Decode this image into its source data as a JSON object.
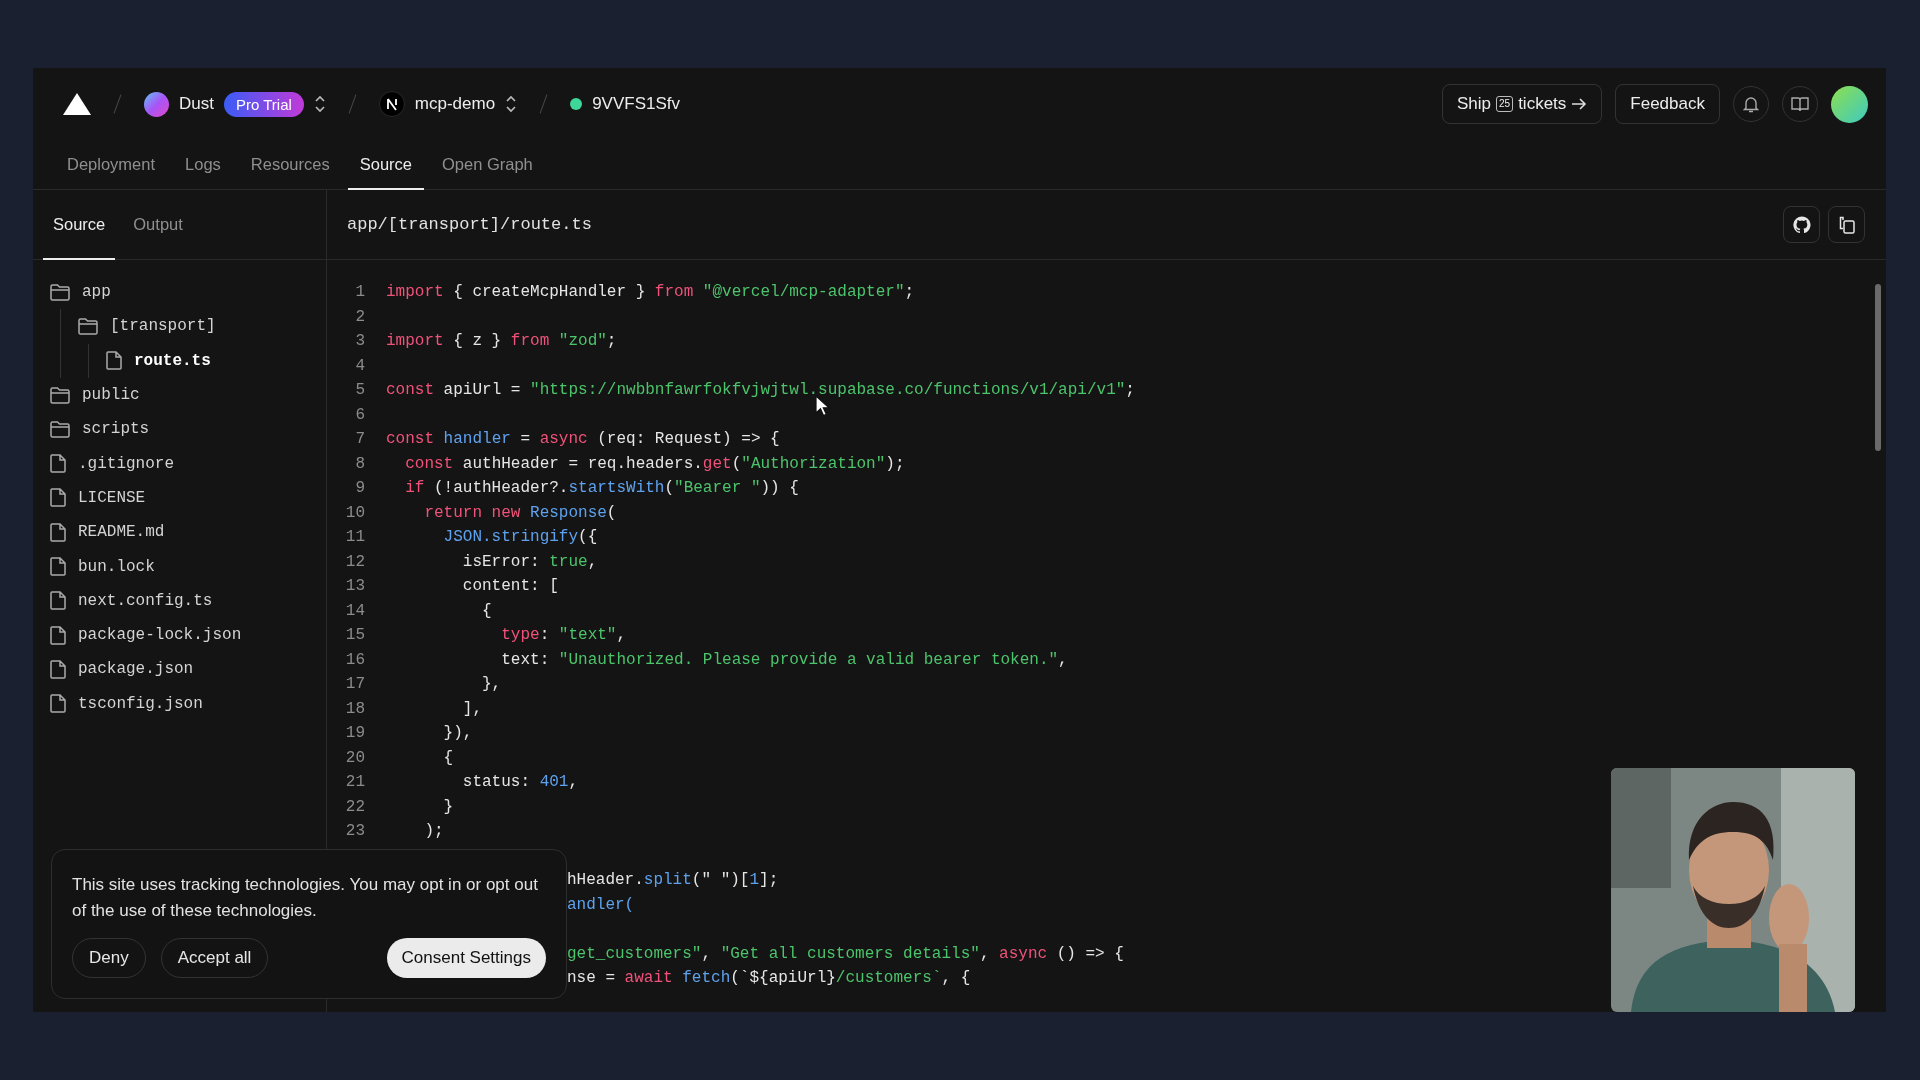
{
  "header": {
    "team": "Dust",
    "plan_badge": "Pro Trial",
    "project": "mcp-demo",
    "deployment": "9VVFS1Sfv",
    "ship_button": {
      "label": "Ship",
      "count": "25",
      "suffix": "tickets"
    },
    "feedback_button": "Feedback"
  },
  "tabs": [
    {
      "label": "Deployment",
      "selected": false
    },
    {
      "label": "Logs",
      "selected": false
    },
    {
      "label": "Resources",
      "selected": false
    },
    {
      "label": "Source",
      "selected": true
    },
    {
      "label": "Open Graph",
      "selected": false
    }
  ],
  "panel_tabs": [
    {
      "label": "Source",
      "selected": true
    },
    {
      "label": "Output",
      "selected": false
    }
  ],
  "file_tree": [
    {
      "name": "app",
      "kind": "folder",
      "selected": false,
      "children": [
        {
          "name": "[transport]",
          "kind": "folder",
          "selected": false,
          "children": [
            {
              "name": "route.ts",
              "kind": "file",
              "selected": true
            }
          ]
        }
      ]
    },
    {
      "name": "public",
      "kind": "folder",
      "selected": false
    },
    {
      "name": "scripts",
      "kind": "folder",
      "selected": false
    },
    {
      "name": ".gitignore",
      "kind": "file",
      "selected": false
    },
    {
      "name": "LICENSE",
      "kind": "file",
      "selected": false
    },
    {
      "name": "README.md",
      "kind": "file",
      "selected": false
    },
    {
      "name": "bun.lock",
      "kind": "file",
      "selected": false
    },
    {
      "name": "next.config.ts",
      "kind": "file",
      "selected": false
    },
    {
      "name": "package-lock.json",
      "kind": "file",
      "selected": false
    },
    {
      "name": "package.json",
      "kind": "file",
      "selected": false
    },
    {
      "name": "tsconfig.json",
      "kind": "file",
      "selected": false
    }
  ],
  "file_path": "app/[transport]/route.ts",
  "code_lines": [
    {
      "kind": "full",
      "number": "1",
      "tokens": [
        {
          "kind": "keyword",
          "text": "import"
        },
        {
          "kind": "plain",
          "text": " { createMcpHandler } "
        },
        {
          "kind": "keyword",
          "text": "from"
        },
        {
          "kind": "string",
          "text": " \"@vercel/mcp-adapter\""
        },
        {
          "kind": "plain",
          "text": ";"
        }
      ]
    },
    {
      "kind": "full",
      "number": "2"
    },
    {
      "kind": "full",
      "number": "3",
      "tokens": [
        {
          "kind": "keyword",
          "text": "import"
        },
        {
          "kind": "plain",
          "text": " { z } "
        },
        {
          "kind": "keyword",
          "text": "from"
        },
        {
          "kind": "string",
          "text": " \"zod\""
        },
        {
          "kind": "plain",
          "text": ";"
        }
      ]
    },
    {
      "kind": "full",
      "number": "4"
    },
    {
      "kind": "full",
      "number": "5",
      "tokens": [
        {
          "kind": "keyword",
          "text": "const"
        },
        {
          "kind": "plain",
          "text": " apiUrl = "
        },
        {
          "kind": "string",
          "text": "\"https://nwbbnfawrfokfvjwjtwl.supabase.co/functions/v1/api/v1\""
        },
        {
          "kind": "plain",
          "text": ";"
        }
      ]
    },
    {
      "kind": "full",
      "number": "6"
    },
    {
      "kind": "full",
      "number": "7",
      "tokens": [
        {
          "kind": "keyword",
          "text": "const"
        },
        {
          "kind": "function",
          "text": " handler"
        },
        {
          "kind": "plain",
          "text": " = "
        },
        {
          "kind": "keyword",
          "text": "async"
        },
        {
          "kind": "plain",
          "text": " (req: Request) => {"
        }
      ]
    },
    {
      "kind": "full",
      "number": "8",
      "tokens": [
        {
          "kind": "keyword",
          "text": "  const"
        },
        {
          "kind": "plain",
          "text": " authHeader = req.headers."
        },
        {
          "kind": "keyword",
          "text": "get"
        },
        {
          "kind": "plain",
          "text": "("
        },
        {
          "kind": "string",
          "text": "\"Authorization\""
        },
        {
          "kind": "plain",
          "text": ");"
        }
      ]
    },
    {
      "kind": "full",
      "number": "9",
      "tokens": [
        {
          "kind": "keyword",
          "text": "  if"
        },
        {
          "kind": "plain",
          "text": " (!authHeader?."
        },
        {
          "kind": "function",
          "text": "startsWith"
        },
        {
          "kind": "plain",
          "text": "("
        },
        {
          "kind": "string",
          "text": "\"Bearer \""
        },
        {
          "kind": "plain",
          "text": ")) {"
        }
      ]
    },
    {
      "kind": "full",
      "number": "10",
      "tokens": [
        {
          "kind": "keyword",
          "text": "    return new"
        },
        {
          "kind": "function",
          "text": " Response"
        },
        {
          "kind": "plain",
          "text": "("
        }
      ]
    },
    {
      "kind": "full",
      "number": "11",
      "tokens": [
        {
          "kind": "function",
          "text": "      JSON.stringify"
        },
        {
          "kind": "plain",
          "text": "({"
        }
      ]
    },
    {
      "kind": "full",
      "number": "12",
      "tokens": [
        {
          "kind": "plain",
          "text": "        isError: "
        },
        {
          "kind": "string",
          "text": "true"
        },
        {
          "kind": "plain",
          "text": ","
        }
      ]
    },
    {
      "kind": "full",
      "number": "13",
      "tokens": [
        {
          "kind": "plain",
          "text": "        content: ["
        }
      ]
    },
    {
      "kind": "full",
      "number": "14",
      "tokens": [
        {
          "kind": "plain",
          "text": "          {"
        }
      ]
    },
    {
      "kind": "full",
      "number": "15",
      "tokens": [
        {
          "kind": "keyword",
          "text": "            type"
        },
        {
          "kind": "plain",
          "text": ": "
        },
        {
          "kind": "string",
          "text": "\"text\""
        },
        {
          "kind": "plain",
          "text": ","
        }
      ]
    },
    {
      "kind": "full",
      "number": "16",
      "tokens": [
        {
          "kind": "plain",
          "text": "            text: "
        },
        {
          "kind": "string",
          "text": "\"Unauthorized. Please provide a valid bearer token.\""
        },
        {
          "kind": "plain",
          "text": ","
        }
      ]
    },
    {
      "kind": "full",
      "number": "17",
      "tokens": [
        {
          "kind": "plain",
          "text": "          },"
        }
      ]
    },
    {
      "kind": "full",
      "number": "18",
      "tokens": [
        {
          "kind": "plain",
          "text": "        ],"
        }
      ]
    },
    {
      "kind": "full",
      "number": "19",
      "tokens": [
        {
          "kind": "plain",
          "text": "      }),"
        }
      ]
    },
    {
      "kind": "full",
      "number": "20",
      "tokens": [
        {
          "kind": "plain",
          "text": "      {"
        }
      ]
    },
    {
      "kind": "full",
      "number": "21",
      "tokens": [
        {
          "kind": "plain",
          "text": "        status: "
        },
        {
          "kind": "number",
          "text": "401"
        },
        {
          "kind": "plain",
          "text": ","
        }
      ]
    },
    {
      "kind": "full",
      "number": "22",
      "tokens": [
        {
          "kind": "plain",
          "text": "      }"
        }
      ]
    },
    {
      "kind": "full",
      "number": "23",
      "tokens": [
        {
          "kind": "plain",
          "text": "    );"
        }
      ]
    },
    {
      "kind": "covered"
    },
    {
      "kind": "partial",
      "tokens": [
        {
          "kind": "plain",
          "text": "hHeader."
        },
        {
          "kind": "function",
          "text": "split"
        },
        {
          "kind": "plain",
          "text": "(\" \")["
        },
        {
          "kind": "number",
          "text": "1"
        },
        {
          "kind": "plain",
          "text": "];"
        }
      ]
    },
    {
      "kind": "partial",
      "tokens": [
        {
          "kind": "function",
          "text": "andler("
        }
      ]
    },
    {
      "kind": "covered"
    },
    {
      "kind": "partial",
      "tokens": [
        {
          "kind": "string",
          "text": "get_customers\""
        },
        {
          "kind": "plain",
          "text": ", "
        },
        {
          "kind": "string",
          "text": "\"Get all customers details\""
        },
        {
          "kind": "plain",
          "text": ", "
        },
        {
          "kind": "keyword",
          "text": "async"
        },
        {
          "kind": "plain",
          "text": " () => {"
        }
      ]
    },
    {
      "kind": "partial",
      "tokens": [
        {
          "kind": "plain",
          "text": "nse = "
        },
        {
          "kind": "keyword",
          "text": "await"
        },
        {
          "kind": "function",
          "text": " fetch"
        },
        {
          "kind": "plain",
          "text": "(`${apiUrl}"
        },
        {
          "kind": "string",
          "text": "/customers`"
        },
        {
          "kind": "plain",
          "text": ", {"
        }
      ]
    }
  ],
  "cookie_banner": {
    "message": "This site uses tracking technologies. You may opt in or opt out of the use of these technologies.",
    "buttons": [
      {
        "label": "Deny",
        "kind": "outline"
      },
      {
        "label": "Accept all",
        "kind": "outline"
      },
      {
        "label": "Consent Settings",
        "kind": "filled"
      }
    ]
  }
}
